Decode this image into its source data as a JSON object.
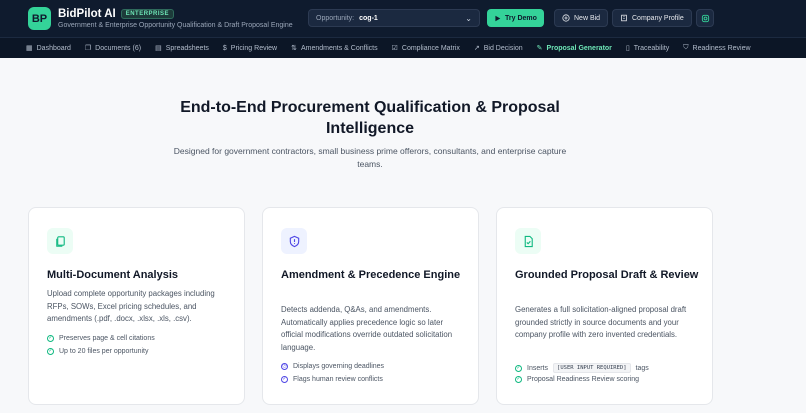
{
  "brand": {
    "logo_text": "BP",
    "name": "BidPilot AI",
    "badge": "ENTERPRISE",
    "tagline": "Government & Enterprise Opportunity Qualification & Draft Proposal Engine",
    "accent_color": "#34d399"
  },
  "header": {
    "opportunity_label": "Opportunity:",
    "opportunity_value": "cog-1",
    "try_demo": "Try Demo",
    "new_bid": "New Bid",
    "company_profile": "Company Profile"
  },
  "nav": {
    "items": [
      {
        "label": "Dashboard",
        "icon": "grid-icon"
      },
      {
        "label": "Documents (6)",
        "icon": "documents-icon"
      },
      {
        "label": "Spreadsheets",
        "icon": "table-icon"
      },
      {
        "label": "Pricing Review",
        "icon": "dollar-icon"
      },
      {
        "label": "Amendments & Conflicts",
        "icon": "branch-icon"
      },
      {
        "label": "Compliance Matrix",
        "icon": "checkbox-icon"
      },
      {
        "label": "Bid Decision",
        "icon": "trend-icon"
      },
      {
        "label": "Proposal Generator",
        "icon": "wand-icon"
      },
      {
        "label": "Traceability",
        "icon": "book-icon"
      },
      {
        "label": "Readiness Review",
        "icon": "shield-icon"
      }
    ],
    "active": "Proposal Generator"
  },
  "hero": {
    "title": "End-to-End Procurement Qualification & Proposal Intelligence",
    "subtitle": "Designed for government contractors, small business prime offerors, consultants, and enterprise capture teams."
  },
  "cards": [
    {
      "title": "Multi-Document Analysis",
      "description": "Upload complete opportunity packages including RFPs, SOWs, Excel pricing schedules, and amendments (.pdf, .docx, .xlsx, .xls, .csv).",
      "features": [
        "Preserves page & cell citations",
        "Up to 20 files per opportunity"
      ]
    },
    {
      "title": "Amendment & Precedence Engine",
      "description": "Detects addenda, Q&As, and amendments. Automatically applies precedence logic so later official modifications override outdated solicitation language.",
      "features": [
        "Displays governing deadlines",
        "Flags human review conflicts"
      ]
    },
    {
      "title": "Grounded Proposal Draft & Review",
      "description": "Generates a full solicitation-aligned proposal draft grounded strictly in source documents and your company profile with zero invented credentials.",
      "features_prefix": "Inserts",
      "features_tag": "[USER INPUT REQUIRED]",
      "features_suffix": "tags",
      "features": [
        "Proposal Readiness Review scoring"
      ]
    }
  ]
}
